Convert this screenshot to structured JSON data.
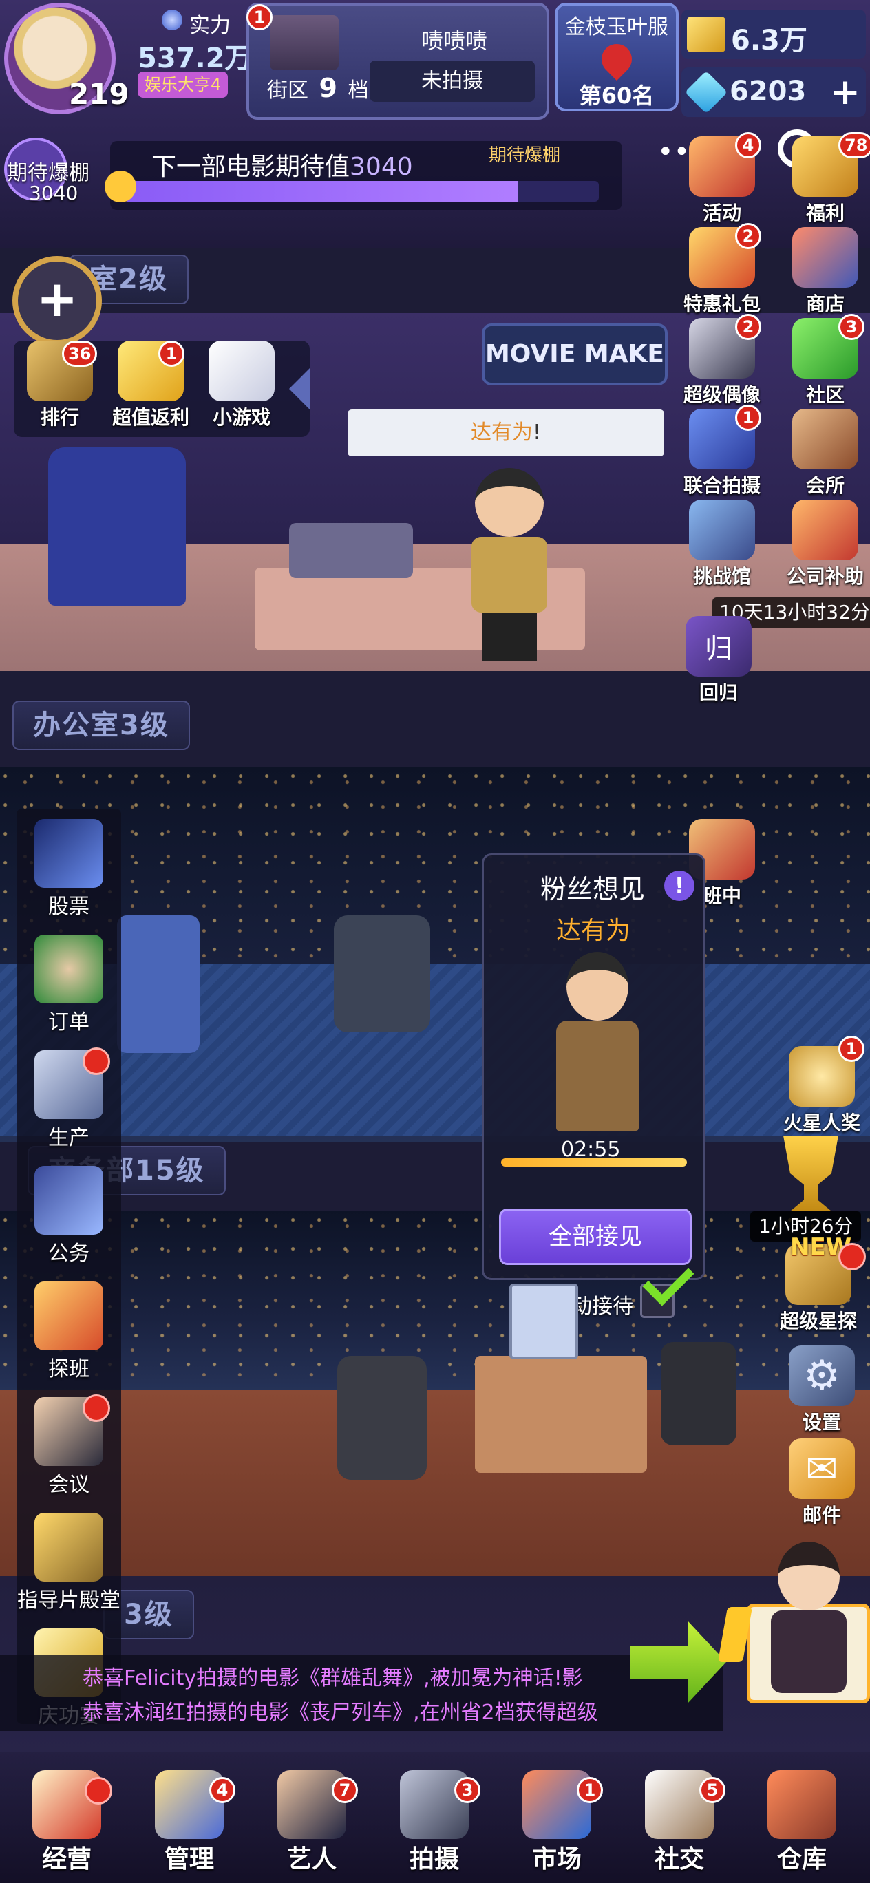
{
  "topbar": {
    "strength_label": "实力",
    "strength_value": "537.2万",
    "rank_title": "娱乐大亨4",
    "level": "219",
    "street_badge": "1",
    "street_name": "啧啧啧",
    "street_district": "街区",
    "street_num": "9",
    "street_tier": "档",
    "street_status": "未拍摄",
    "award_title": "金枝玉叶服",
    "award_rank": "第60名",
    "gold_value": "6.3万",
    "diamond_value": "6203"
  },
  "expectation": {
    "circle_label": "期待爆棚",
    "circle_value": "3040",
    "text": "下一部电影期待值",
    "value": "3040",
    "marker_label": "期待爆棚",
    "progress_percent": 83
  },
  "side_right": [
    {
      "name": "activity",
      "label": "活动",
      "badge": "4",
      "icon": "gift-icon"
    },
    {
      "name": "welfare",
      "label": "福利",
      "badge": "78",
      "icon": "money-icon"
    },
    {
      "name": "special-gift",
      "label": "特惠礼包",
      "badge": "2",
      "icon": "giftbox-icon"
    },
    {
      "name": "shop",
      "label": "商店",
      "badge": "",
      "icon": "shop-icon"
    },
    {
      "name": "super-idol",
      "label": "超级偶像",
      "badge": "2",
      "icon": "clapper-icon"
    },
    {
      "name": "community",
      "label": "社区",
      "badge": "3",
      "icon": "chat-icon"
    },
    {
      "name": "joint-shoot",
      "label": "联合拍摄",
      "badge": "1",
      "icon": "film-icon"
    },
    {
      "name": "club",
      "label": "会所",
      "badge": "",
      "icon": "house-icon"
    },
    {
      "name": "challenge",
      "label": "挑战馆",
      "badge": "",
      "icon": "arena-icon"
    },
    {
      "name": "company-subsidy",
      "label": "公司补助",
      "badge": "",
      "icon": "gift-icon"
    }
  ],
  "subsidy_timer": "10天13小时32分",
  "return_label": "回归",
  "room_labels": {
    "room2": "室2级",
    "office": "办公室3级",
    "business": "商务部15级",
    "room_bottom": "3级"
  },
  "quick_menu": [
    {
      "label": "排行",
      "badge": "36",
      "icon": "trophy-icon"
    },
    {
      "label": "超值返利",
      "badge": "1",
      "icon": "coupon-icon"
    },
    {
      "label": "小游戏",
      "badge": "",
      "icon": "gamepad-icon"
    }
  ],
  "studio_sign": "MOVIE MAKE",
  "speech": {
    "name": "达有为",
    "punct": "!"
  },
  "fan_popup": {
    "title": "粉丝想见",
    "name": "达有为",
    "timer": "02:55",
    "timer_progress": 100,
    "button": "全部接见",
    "auto_label": "自动接待"
  },
  "visit_label": "班中",
  "mars_award": {
    "label": "火星人奖",
    "badge": "1"
  },
  "trophy_timer": "1小时26分",
  "super_scout": {
    "label": "超级星探",
    "new": "NEW"
  },
  "settings_label": "设置",
  "mail_label": "邮件",
  "left_menu": [
    {
      "label": "股票",
      "icon": "stock-icon",
      "dot": false
    },
    {
      "label": "订单",
      "icon": "handshake-icon",
      "dot": false
    },
    {
      "label": "生产",
      "icon": "factory-icon",
      "dot": true
    },
    {
      "label": "公务",
      "icon": "phone-icon",
      "dot": false
    },
    {
      "label": "探班",
      "icon": "bouquet-icon",
      "dot": false
    },
    {
      "label": "会议",
      "icon": "meeting-icon",
      "dot": true
    },
    {
      "label": "指导片殿堂",
      "icon": "trophy-icon",
      "dot": false
    },
    {
      "label": "庆功宴",
      "icon": "star-icon",
      "dot": false
    }
  ],
  "news": [
    "恭喜Felicity拍摄的电影《群雄乱舞》,被加冕为神话!影",
    "恭喜沐润红拍摄的电影《丧尸列车》,在州省2档获得超级"
  ],
  "bottom_tabs": [
    {
      "label": "经营",
      "badge": "",
      "dot": true,
      "icon": "popcorn-icon"
    },
    {
      "label": "管理",
      "badge": "4",
      "dot": false,
      "icon": "cards-icon"
    },
    {
      "label": "艺人",
      "badge": "7",
      "dot": false,
      "icon": "actor-icon"
    },
    {
      "label": "拍摄",
      "badge": "3",
      "dot": false,
      "icon": "camera-icon"
    },
    {
      "label": "市场",
      "badge": "1",
      "dot": false,
      "icon": "chart-icon"
    },
    {
      "label": "社交",
      "badge": "5",
      "dot": false,
      "icon": "coffee-icon"
    },
    {
      "label": "仓库",
      "badge": "",
      "dot": false,
      "icon": "warehouse-icon"
    }
  ]
}
